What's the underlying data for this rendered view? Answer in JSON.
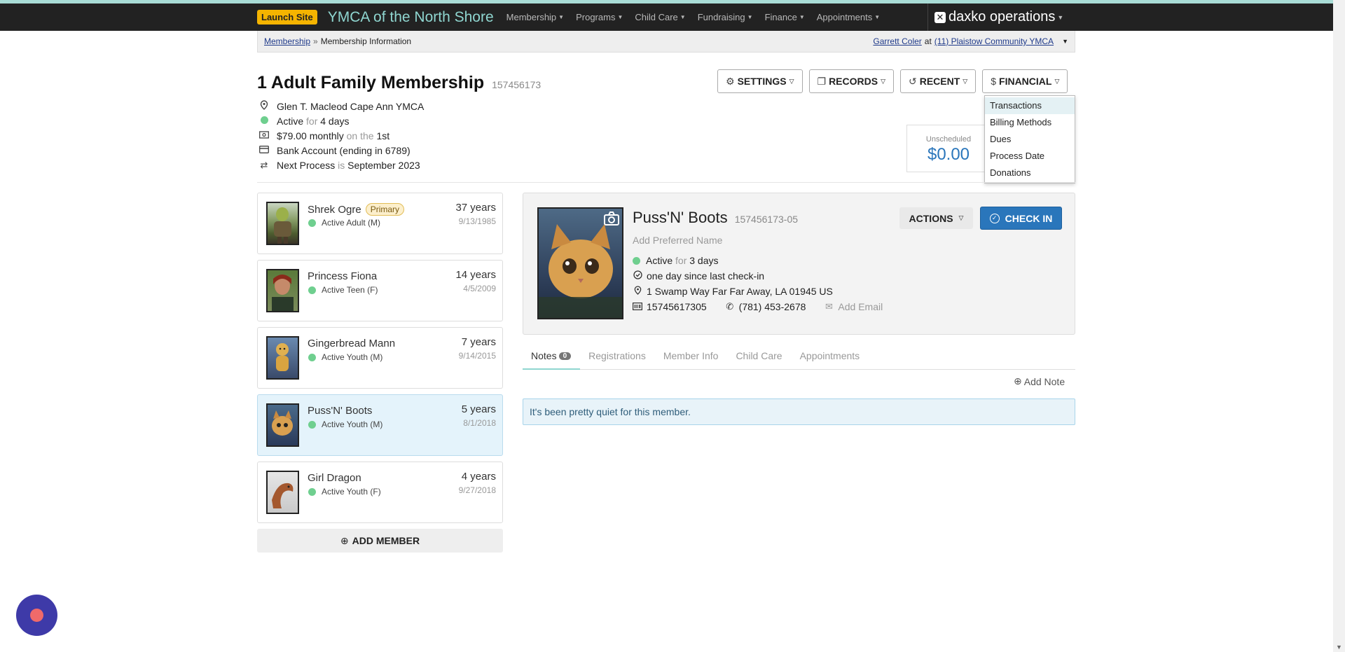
{
  "nav": {
    "launch_site": "Launch Site",
    "org_name": "YMCA of the North Shore",
    "items": [
      "Membership",
      "Programs",
      "Child Care",
      "Fundraising",
      "Finance",
      "Appointments"
    ],
    "brand": "daxko operations"
  },
  "breadcrumb": {
    "link": "Membership",
    "separator": "»",
    "current": "Membership Information",
    "user": "Garrett Coler",
    "at": "at",
    "location": "(11) Plaistow Community YMCA"
  },
  "membership": {
    "title": "1 Adult Family Membership",
    "id": "157456173",
    "branch": "Glen T. Macleod Cape Ann YMCA",
    "status": "Active",
    "for_word": "for",
    "duration": "4 days",
    "amount": "$79.00 monthly",
    "on_the": "on the",
    "day": "1st",
    "payment": "Bank Account (ending in 6789)",
    "next_process_label": "Next Process",
    "is_word": "is",
    "next_process": "September 2023"
  },
  "buttons": {
    "settings": "SETTINGS",
    "records": "RECORDS",
    "recent": "RECENT",
    "financial": "FINANCIAL"
  },
  "financial_menu": [
    "Transactions",
    "Billing Methods",
    "Dues",
    "Process Date",
    "Donations"
  ],
  "unscheduled": {
    "label": "Unscheduled",
    "value": "$0.00"
  },
  "members": [
    {
      "name": "Shrek Ogre",
      "badge": "Primary",
      "status": "Active Adult (M)",
      "age": "37 years",
      "dob": "9/13/1985"
    },
    {
      "name": "Princess Fiona",
      "badge": "",
      "status": "Active Teen (F)",
      "age": "14 years",
      "dob": "4/5/2009"
    },
    {
      "name": "Gingerbread Mann",
      "badge": "",
      "status": "Active Youth (M)",
      "age": "7 years",
      "dob": "9/14/2015"
    },
    {
      "name": "Puss'N' Boots",
      "badge": "",
      "status": "Active Youth (M)",
      "age": "5 years",
      "dob": "8/1/2018"
    },
    {
      "name": "Girl Dragon",
      "badge": "",
      "status": "Active Youth (F)",
      "age": "4 years",
      "dob": "9/27/2018"
    }
  ],
  "add_member": "ADD MEMBER",
  "detail": {
    "name": "Puss'N' Boots",
    "id": "157456173-05",
    "preferred_placeholder": "Add Preferred Name",
    "status": "Active",
    "for_word": "for",
    "duration": "3 days",
    "checkin": "one day since last check-in",
    "address": "1 Swamp Way Far Far Away, LA 01945 US",
    "barcode": "15745617305",
    "phone": "(781) 453-2678",
    "email_placeholder": "Add Email",
    "actions": "ACTIONS",
    "check_in": "CHECK IN"
  },
  "tabs": [
    {
      "label": "Notes",
      "count": "0"
    },
    {
      "label": "Registrations"
    },
    {
      "label": "Member Info"
    },
    {
      "label": "Child Care"
    },
    {
      "label": "Appointments"
    }
  ],
  "add_note": "Add Note",
  "empty_message": "It's been pretty quiet for this member.",
  "colors": {
    "accent": "#2a76bb",
    "teal": "#8fd6d0",
    "active": "#6fcf8f",
    "nav_bg": "#222222"
  },
  "icons": [
    "map-pin-icon",
    "money-icon",
    "credit-card-icon",
    "repeat-icon",
    "gear-icon",
    "copy-icon",
    "history-icon",
    "dollar-icon",
    "camera-icon",
    "check-circle-icon",
    "barcode-icon",
    "phone-icon",
    "envelope-icon",
    "plus-circle-icon",
    "chat-icon"
  ]
}
